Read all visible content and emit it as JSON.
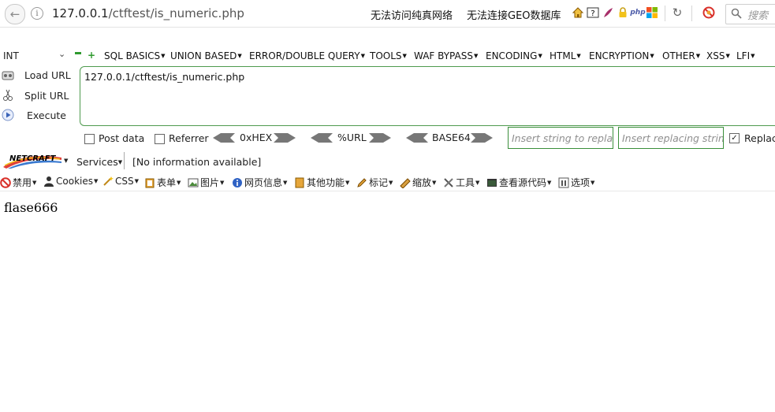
{
  "address_bar": {
    "url_host": "127.0.0.1",
    "url_path": "/ctftest/is_numeric.php",
    "notice_1": "无法访问纯真网络",
    "notice_2": "无法连接GEO数据库",
    "php_badge": "php",
    "search_placeholder": "搜索"
  },
  "hackbar": {
    "type_select": "INT",
    "menus": [
      "SQL BASICS",
      "UNION BASED",
      "ERROR/DOUBLE QUERY",
      "TOOLS",
      "WAF BYPASS",
      "ENCODING",
      "HTML",
      "ENCRYPTION",
      "OTHER",
      "XSS",
      "LFI"
    ],
    "actions": {
      "load": "Load URL",
      "split": "Split URL",
      "execute": "Execute"
    },
    "url_value": "127.0.0.1/ctftest/is_numeric.php",
    "post_data": "Post data",
    "referrer": "Referrer",
    "hex": "0xHEX",
    "url_enc": "%URL",
    "base64": "BASE64",
    "insert_placeholder": "Insert string to replace",
    "replacing_placeholder": "Insert replacing string",
    "replace_all": "Replace All"
  },
  "netcraft": {
    "logo_text": "NETCRAFT",
    "services": "Services",
    "info": "[No information available]"
  },
  "cn_toolbar": {
    "disable": "禁用",
    "cookies": "Cookies",
    "css": "CSS",
    "forms": "表单",
    "images": "图片",
    "page_info": "网页信息",
    "misc": "其他功能",
    "marks": "标记",
    "resize": "缩放",
    "tools": "工具",
    "view_source": "查看源代码",
    "options": "选项"
  },
  "page": {
    "output": "flase666"
  },
  "colors": {
    "accent_green": "#4e9a4e",
    "text": "#222222"
  }
}
